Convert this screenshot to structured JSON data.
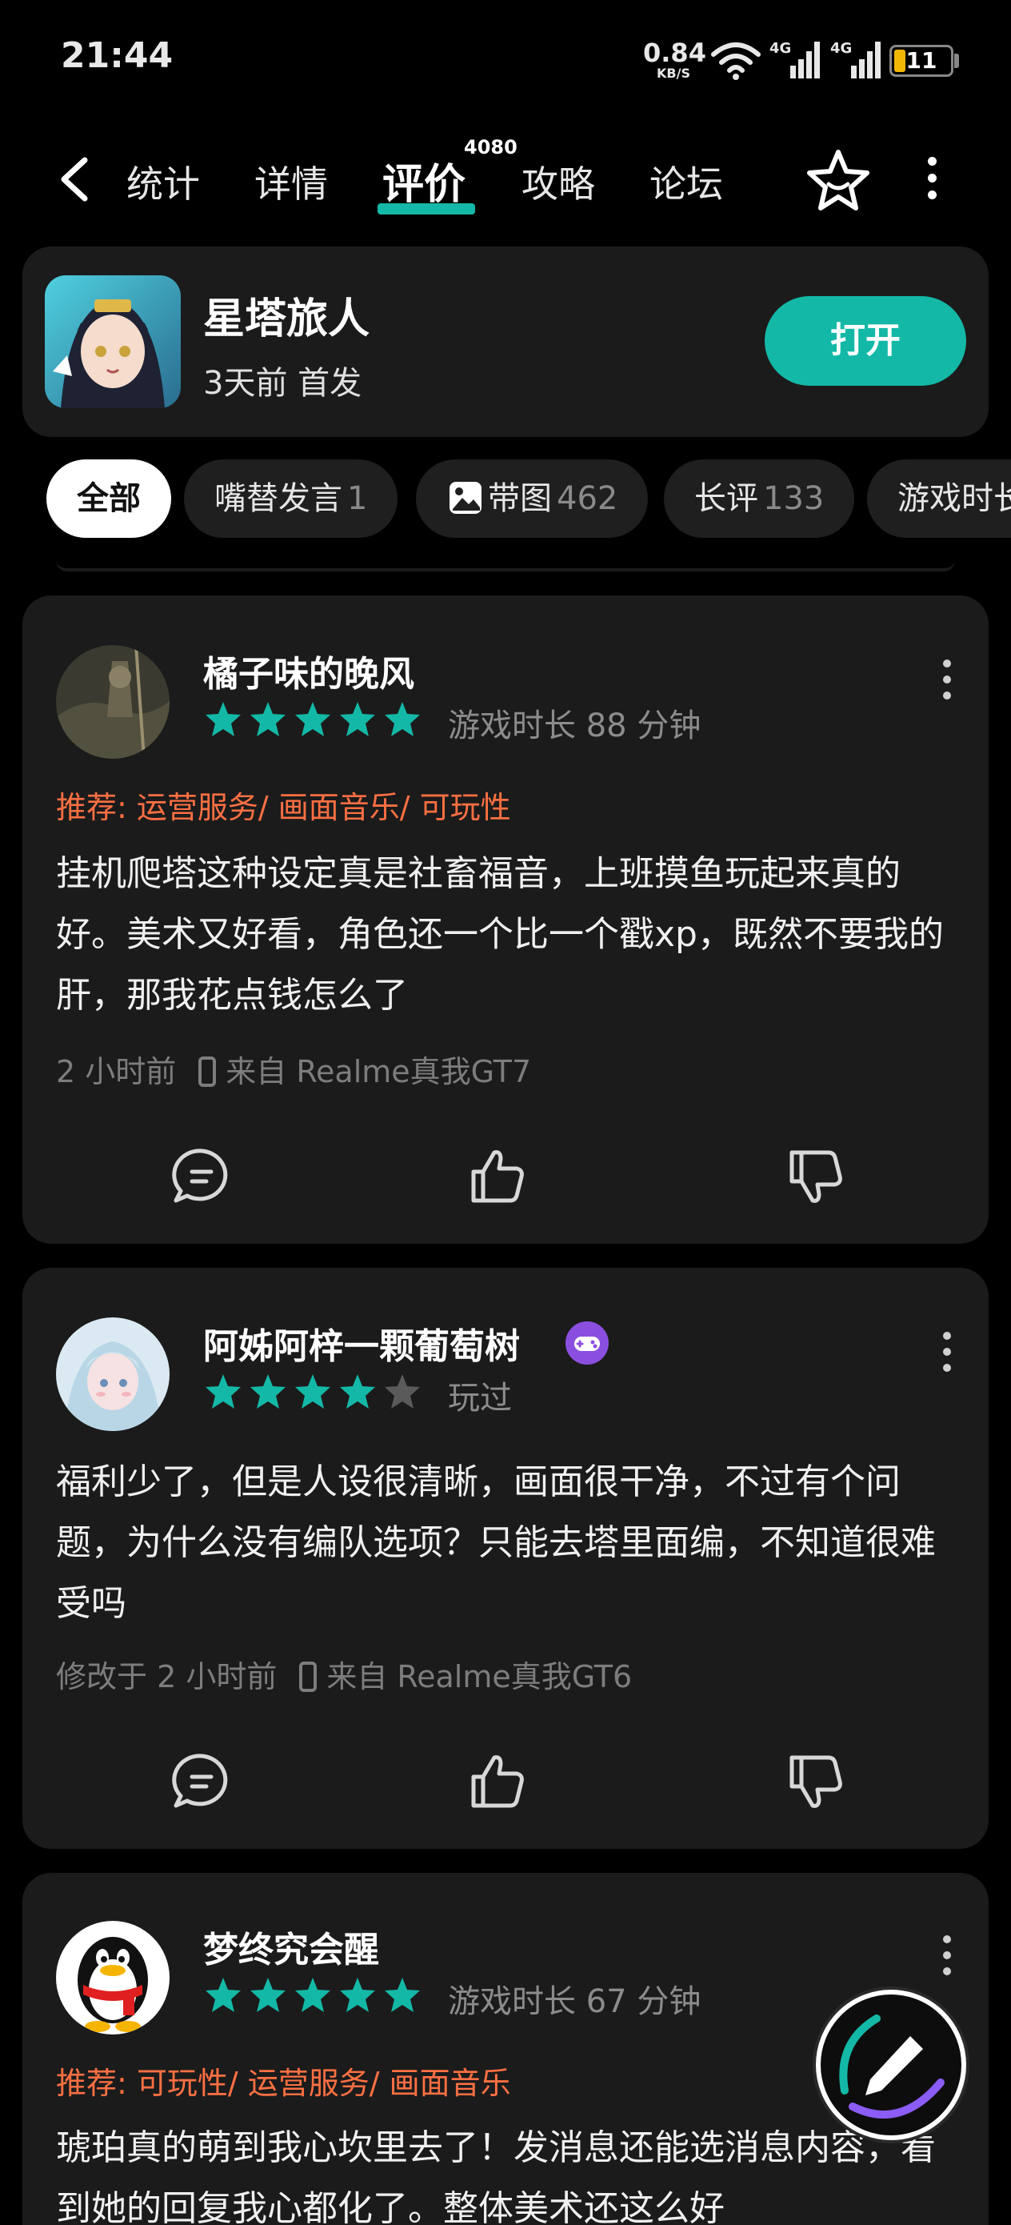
{
  "status_bar": {
    "time": "21:44",
    "net_speed_value": "0.84",
    "net_speed_unit": "KB/S",
    "signal1_label": "4G",
    "signal2_label": "4G",
    "battery_level": "11",
    "battery_color": "#f2b705"
  },
  "nav": {
    "tabs": [
      {
        "label": "统计"
      },
      {
        "label": "详情"
      },
      {
        "label": "评价"
      },
      {
        "label": "攻略"
      },
      {
        "label": "论坛"
      }
    ],
    "active_tab": "评价",
    "review_count_badge": "4080",
    "icons": [
      "back-icon",
      "star-icon",
      "more-icon"
    ]
  },
  "game": {
    "name": "星塔旅人",
    "subtitle": "3天前 首发",
    "open_label": "打开",
    "accent_color": "#14b8a6"
  },
  "filters": [
    {
      "label": "全部",
      "count": ""
    },
    {
      "label": "嘴替发言",
      "count": "1"
    },
    {
      "label": "带图",
      "count": "462"
    },
    {
      "label": "长评",
      "count": "133"
    },
    {
      "label": "游戏时长",
      "count": ""
    }
  ],
  "reviews": [
    {
      "user": "橘子味的晚风",
      "rating": 5,
      "meta": "游戏时长 88 分钟",
      "recommend": "推荐: 运营服务/ 画面音乐/ 可玩性",
      "text": "挂机爬塔这种设定真是社畜福音，上班摸鱼玩起来真的好。美术又好看，角色还一个比一个戳xp，既然不要我的肝，那我花点钱怎么了",
      "time": "2 小时前",
      "device": "来自 Realme真我GT7"
    },
    {
      "user": "阿姊阿梓一颗葡萄树",
      "rating": 4,
      "meta": "玩过",
      "recommend": "",
      "text": "福利少了，但是人设很清晰，画面很干净，不过有个问题，为什么没有编队选项？只能去塔里面编，不知道很难受吗",
      "time": "修改于 2 小时前",
      "device": "来自 Realme真我GT6"
    },
    {
      "user": "梦终究会醒",
      "rating": 5,
      "meta": "游戏时长 67 分钟",
      "recommend": "推荐: 可玩性/ 运营服务/ 画面音乐",
      "text": "琥珀真的萌到我心坎里去了！发消息还能选消息内容，看到她的回复我心都化了。整体美术还这么好",
      "time": "",
      "device": ""
    }
  ],
  "colors": {
    "star_filled": "#14b8a6",
    "star_empty": "#5a5a5a",
    "recommend": "#ff7043",
    "card_bg": "#1b1b1b"
  }
}
